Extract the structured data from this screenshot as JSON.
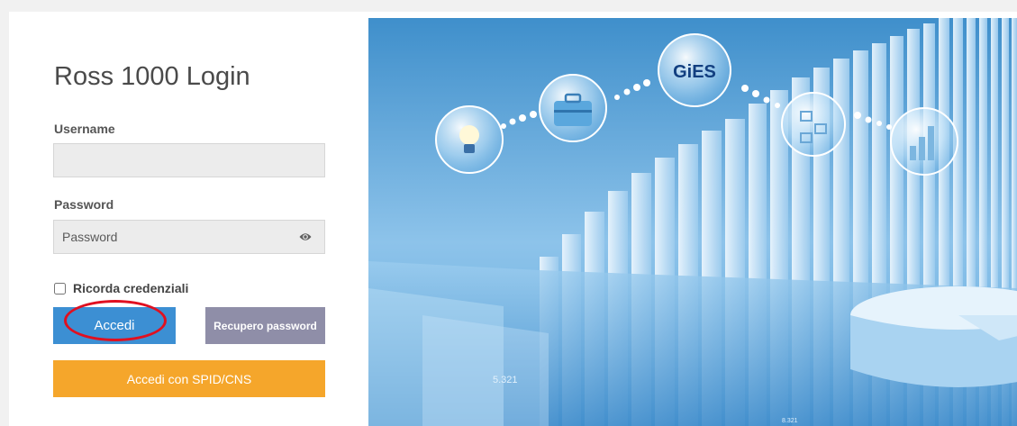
{
  "login": {
    "title": "Ross 1000 Login",
    "username_label": "Username",
    "username_value": "",
    "password_label": "Password",
    "password_placeholder": "Password",
    "remember_label": "Ricorda credenziali",
    "accedi_label": "Accedi",
    "recupero_label": "Recupero password",
    "spid_label": "Accedi con SPID/CNS"
  },
  "hero": {
    "logo_text": "GiES",
    "number_1": "5.321",
    "number_2": "8.321"
  },
  "colors": {
    "primary": "#3c8fd3",
    "secondary": "#8f8ea8",
    "spid": "#f5a62b",
    "highlight": "#e01020"
  },
  "icons": [
    "eye-icon",
    "lightbulb-icon",
    "briefcase-icon",
    "network-icon",
    "bar-chart-icon"
  ]
}
